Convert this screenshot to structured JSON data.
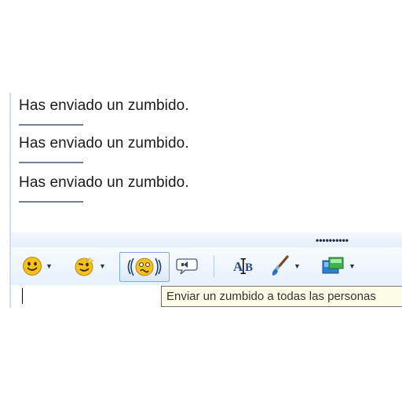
{
  "history": {
    "messages": [
      "Has enviado un zumbido.",
      "Has enviado un zumbido.",
      "Has enviado un zumbido."
    ]
  },
  "splitter": {
    "grip": "••••••••••"
  },
  "toolbar": {
    "buttons": [
      {
        "name": "emoticon-button",
        "icon": "smiley-icon"
      },
      {
        "name": "wink-button",
        "icon": "wink-icon"
      },
      {
        "name": "nudge-button",
        "icon": "nudge-icon",
        "active": true
      },
      {
        "name": "voice-clip-button",
        "icon": "speech-bubble-icon"
      },
      {
        "name": "font-button",
        "icon": "font-icon"
      },
      {
        "name": "background-button",
        "icon": "paintbrush-icon"
      },
      {
        "name": "games-button",
        "icon": "games-icon"
      }
    ],
    "dropdown_arrow": "▼"
  },
  "tooltip": {
    "text": "Enviar un zumbido a todas las personas"
  },
  "colors": {
    "accent": "#cfe0f1",
    "tooltip_bg": "#fdfde8",
    "smiley": "#f4c21a"
  }
}
